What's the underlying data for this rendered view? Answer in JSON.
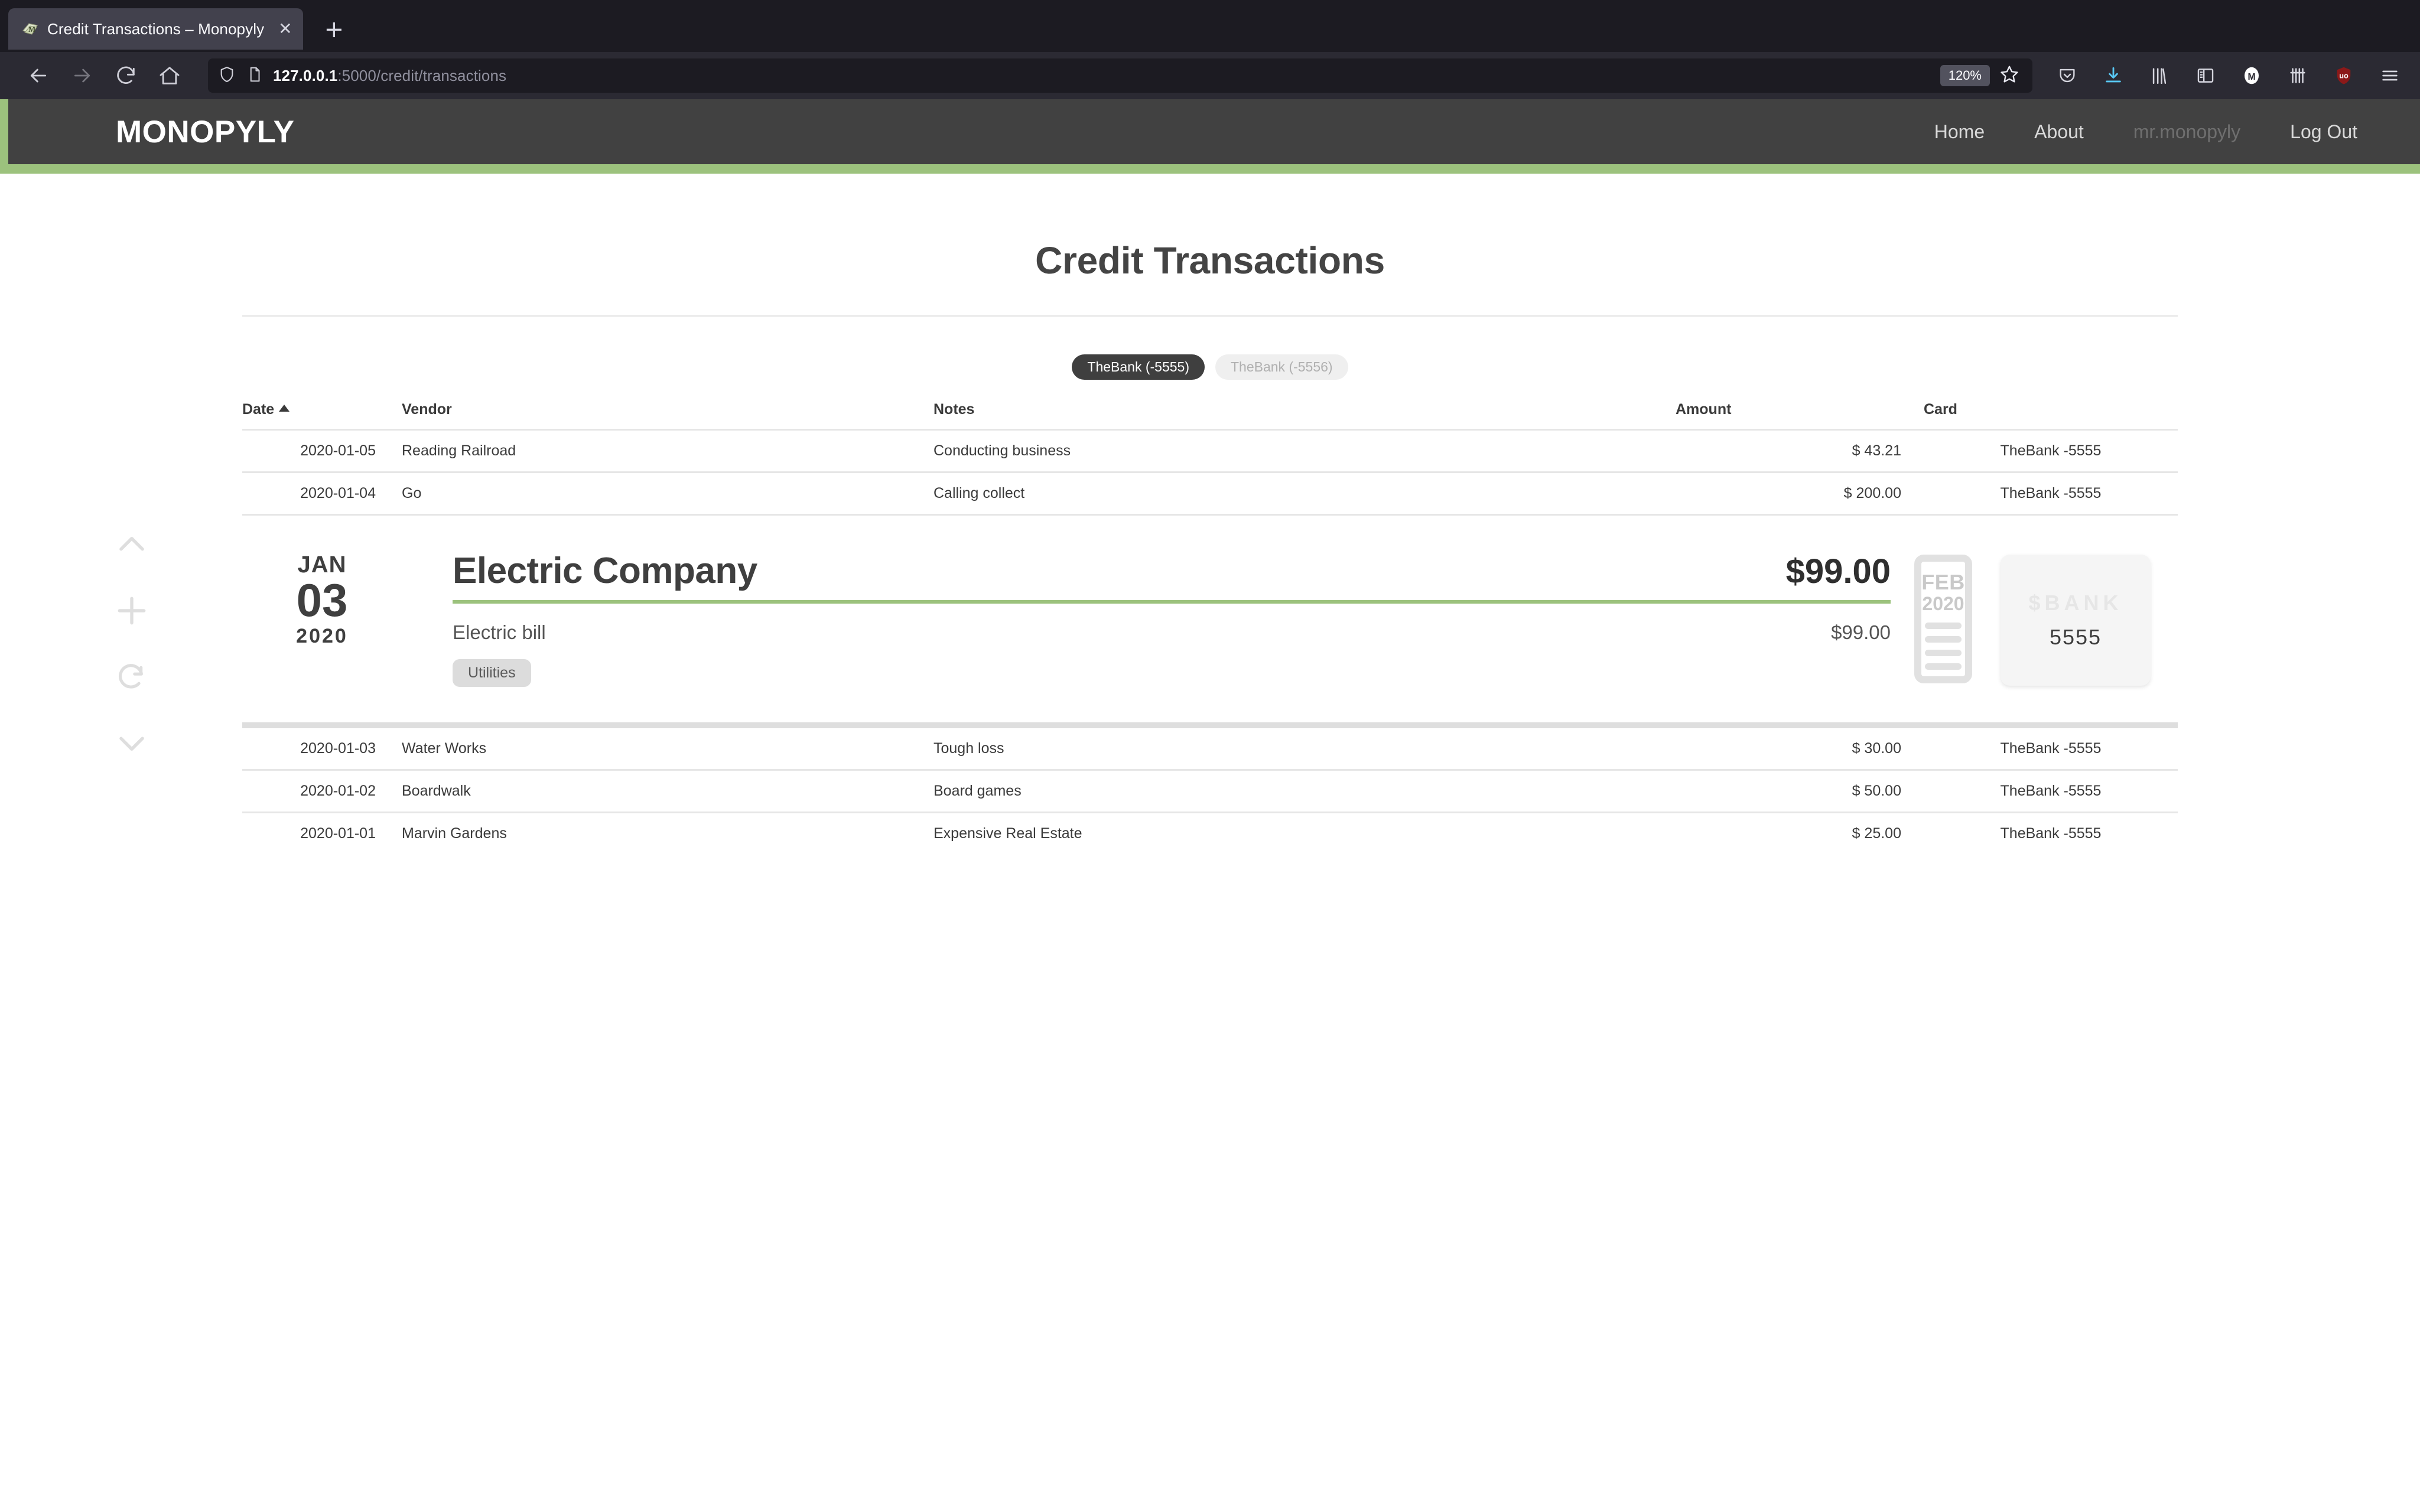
{
  "browser": {
    "tab": {
      "title": "Credit Transactions – Monopyly",
      "favicon": "monopyly-money-icon",
      "close_label": "✕"
    },
    "new_tab_label": "+",
    "nav_buttons": [
      {
        "name": "back",
        "icon": "arrow-left-icon"
      },
      {
        "name": "forward",
        "icon": "arrow-right-icon"
      },
      {
        "name": "reload",
        "icon": "reload-icon"
      },
      {
        "name": "home",
        "icon": "home-icon"
      }
    ],
    "url": {
      "host": "127.0.0.1",
      "path": ":5000/credit/transactions",
      "full": "127.0.0.1:5000/credit/transactions",
      "shield_icon": "shield-icon",
      "page_icon": "page-icon"
    },
    "zoom_level": "120%",
    "bookmark_icon": "star-icon",
    "toolbar_icons": [
      {
        "name": "pocket-icon"
      },
      {
        "name": "downloads-icon"
      },
      {
        "name": "library-icon"
      },
      {
        "name": "sidebar-icon"
      },
      {
        "name": "account-icon",
        "letter": "M"
      },
      {
        "name": "containers-icon"
      },
      {
        "name": "ublock-origin-icon",
        "letter": "uօ"
      },
      {
        "name": "app-menu-icon"
      }
    ]
  },
  "site": {
    "brand": "MONOPYLY",
    "nav_links": [
      {
        "label": "Home",
        "muted": false
      },
      {
        "label": "About",
        "muted": false
      },
      {
        "label": "mr.monopyly",
        "muted": true
      },
      {
        "label": "Log Out",
        "muted": false
      }
    ],
    "accent_green": "#9cc27d",
    "nav_background": "#414141"
  },
  "rail": {
    "buttons": [
      {
        "name": "scroll-up",
        "icon": "chevron-up-icon"
      },
      {
        "name": "add-transaction",
        "icon": "plus-icon"
      },
      {
        "name": "refresh",
        "icon": "refresh-icon"
      },
      {
        "name": "scroll-down",
        "icon": "chevron-down-icon"
      }
    ]
  },
  "page": {
    "title": "Credit Transactions",
    "account_filters": [
      {
        "label": "TheBank (-5555)",
        "active": true
      },
      {
        "label": "TheBank (-5556)",
        "active": false
      }
    ],
    "table": {
      "headers": {
        "date": "Date",
        "vendor": "Vendor",
        "notes": "Notes",
        "amount": "Amount",
        "card": "Card"
      },
      "sort": {
        "column": "Date",
        "direction": "asc",
        "caret": "▲"
      },
      "rows_top": [
        {
          "date": "2020-01-05",
          "vendor": "Reading Railroad",
          "notes": "Conducting business",
          "amount": "$ 43.21",
          "card": "TheBank -5555"
        },
        {
          "date": "2020-01-04",
          "vendor": "Go",
          "notes": "Calling collect",
          "amount": "$ 200.00",
          "card": "TheBank -5555"
        }
      ],
      "rows_bottom": [
        {
          "date": "2020-01-03",
          "vendor": "Water Works",
          "notes": "Tough loss",
          "amount": "$ 30.00",
          "card": "TheBank -5555"
        },
        {
          "date": "2020-01-02",
          "vendor": "Boardwalk",
          "notes": "Board games",
          "amount": "$ 50.00",
          "card": "TheBank -5555"
        },
        {
          "date": "2020-01-01",
          "vendor": "Marvin Gardens",
          "notes": "Expensive Real Estate",
          "amount": "$ 25.00",
          "card": "TheBank -5555"
        }
      ]
    },
    "expanded_transaction": {
      "date": {
        "month": "JAN",
        "day": "03",
        "year": "2020"
      },
      "vendor": "Electric Company",
      "amount": "$99.00",
      "note": "Electric bill",
      "subtotal": "$99.00",
      "tags": [
        "Utilities"
      ],
      "statement": {
        "month": "FEB",
        "year": "2020",
        "icon": "receipt-icon"
      },
      "card": {
        "bank": "$BANK",
        "last_four": "5555",
        "icon": "credit-card-icon"
      }
    }
  }
}
